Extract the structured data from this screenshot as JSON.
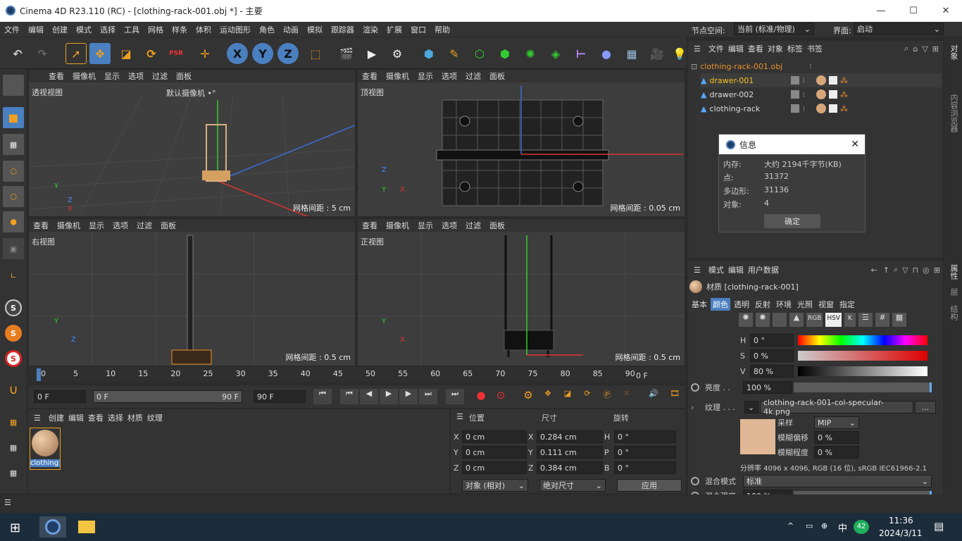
{
  "window": {
    "title": "Cinema 4D R23.110 (RC) - [clothing-rack-001.obj *] - 主要"
  },
  "menu": [
    "文件",
    "编辑",
    "创建",
    "模式",
    "选择",
    "工具",
    "网格",
    "样条",
    "体积",
    "运动图形",
    "角色",
    "动画",
    "模拟",
    "跟踪器",
    "渲染",
    "扩展",
    "窗口",
    "帮助"
  ],
  "right_top": {
    "node_space_label": "节点空间:",
    "node_space_value": "当前 (标准/物理)",
    "layout_label": "界面:",
    "layout_value": "启动"
  },
  "viewport_menu": [
    "查看",
    "摄像机",
    "显示",
    "选项",
    "过滤",
    "面板"
  ],
  "viewports": [
    {
      "name": "透视视图",
      "camera": "默认摄像机 •°",
      "grid": "网格间距 : 5 cm"
    },
    {
      "name": "顶视图",
      "grid": "网格间距 : 0.05 cm"
    },
    {
      "name": "右视图",
      "grid": "网格间距 : 0.5 cm"
    },
    {
      "name": "正视图",
      "grid": "网格间距 : 0.5 cm"
    }
  ],
  "objects_menu": [
    "文件",
    "编辑",
    "查看",
    "对象",
    "标签",
    "书签"
  ],
  "objects": [
    {
      "name": "clothing-rack-001.obj",
      "color": "#e8912e"
    },
    {
      "name": "drawer-001",
      "color": "#f0c020"
    },
    {
      "name": "drawer-002",
      "color": "#dddddd"
    },
    {
      "name": "clothing-rack",
      "color": "#dddddd"
    }
  ],
  "side_tabs": {
    "objects": "对象",
    "content": "内容浏览器",
    "attributes": "属性",
    "layers": "层",
    "structure": "结构"
  },
  "info_dialog": {
    "title": "信息",
    "rows": [
      {
        "k": "内存:",
        "v": "大约 2194千字节(KB)"
      },
      {
        "k": "点:",
        "v": "31372"
      },
      {
        "k": "多边形:",
        "v": "31136"
      },
      {
        "k": "对象:",
        "v": "4"
      }
    ],
    "ok": "确定"
  },
  "attr_menu": [
    "模式",
    "编辑",
    "用户数据"
  ],
  "material_title": "材质 [clothing-rack-001]",
  "mat_tabs": [
    "基本",
    "颜色",
    "透明",
    "反射",
    "环境",
    "光照",
    "视窗",
    "指定"
  ],
  "active_tab": "颜色",
  "color_icons": [
    "RGB",
    "HSV",
    "K"
  ],
  "hsv": [
    {
      "k": "H",
      "v": "0 °"
    },
    {
      "k": "S",
      "v": "0 %"
    },
    {
      "k": "V",
      "v": "80 %"
    }
  ],
  "brightness": {
    "label": "亮度 . .",
    "value": "100 %"
  },
  "texture": {
    "label": "纹理 . . .",
    "file": "clothing-rack-001-col-specular-4k.png",
    "more": "...",
    "sample_label": "采样",
    "sample_value": "MIP",
    "blur_offset_label": "模糊偏移",
    "blur_offset_value": "0 %",
    "blur_scale_label": "模糊程度",
    "blur_scale_value": "0 %",
    "resolution": "分辨率 4096 x 4096, RGB (16 位), sRGB IEC61966-2.1"
  },
  "mix_mode": {
    "label": "混合模式",
    "value": "标准"
  },
  "mix_strength": {
    "label": "混合强度",
    "value": "100 %"
  },
  "timeline": {
    "ticks": [
      "0",
      "5",
      "10",
      "15",
      "20",
      "25",
      "30",
      "35",
      "40",
      "45",
      "50",
      "55",
      "60",
      "65",
      "70",
      "75",
      "80",
      "85",
      "90"
    ],
    "frame_end": "0 F",
    "start": "0 F",
    "range_start": "0 F",
    "range_end": "90 F",
    "max": "90 F"
  },
  "material_menu": [
    "创建",
    "编辑",
    "查看",
    "选择",
    "材质",
    "纹理"
  ],
  "material_name": "clothing",
  "coords": {
    "headers": [
      "位置",
      "尺寸",
      "旋转"
    ],
    "rows": [
      {
        "a": "X",
        "p": "0 cm",
        "b": "X",
        "s": "0.284 cm",
        "c": "H",
        "r": "0 °"
      },
      {
        "a": "Y",
        "p": "0 cm",
        "b": "Y",
        "s": "0.111 cm",
        "c": "P",
        "r": "0 °"
      },
      {
        "a": "Z",
        "p": "0 cm",
        "b": "Z",
        "s": "0.384 cm",
        "c": "B",
        "r": "0 °"
      }
    ],
    "mode": "对象 (相对)",
    "size_mode": "绝对尺寸",
    "apply": "应用"
  },
  "taskbar": {
    "time": "11:36",
    "date": "2024/3/11",
    "ime": "中",
    "badge": "42"
  }
}
